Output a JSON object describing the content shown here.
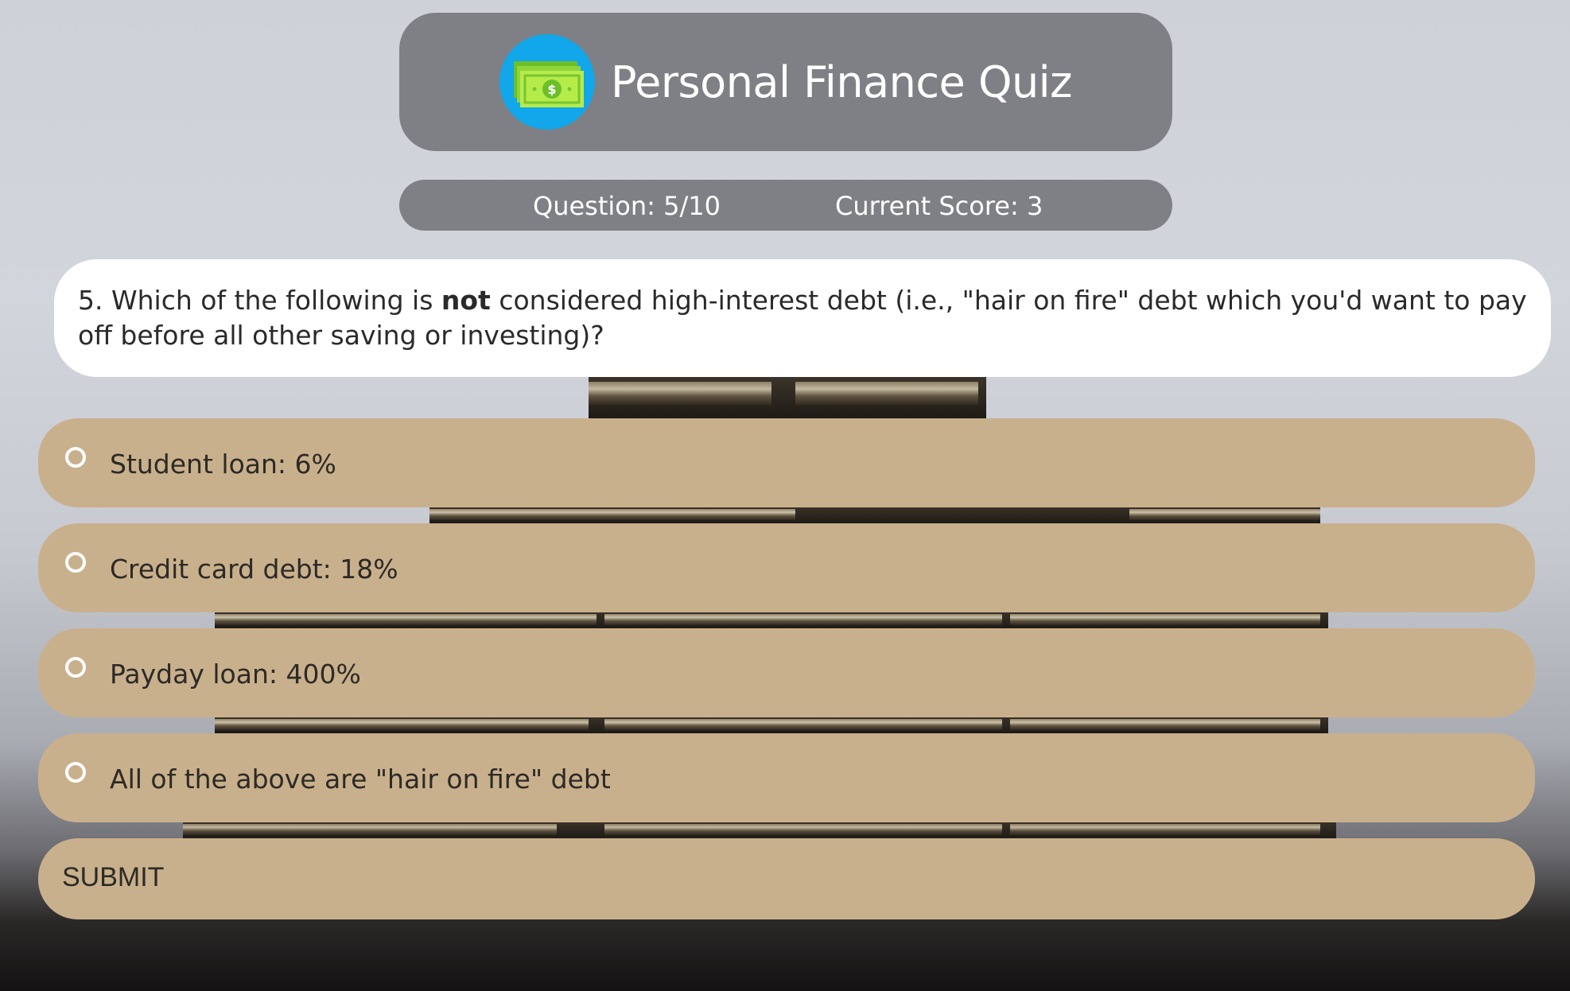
{
  "app": {
    "title": "Personal Finance Quiz",
    "logo_icon": "cash-money-icon",
    "colors": {
      "header_bg": "#7f8085",
      "logo_bg": "#12a6ea",
      "option_bg": "#c9b08c",
      "card_bg": "#ffffff"
    }
  },
  "status": {
    "question_label": "Question: 5/10",
    "score_label": "Current Score: 3",
    "question_current": 5,
    "question_total": 10,
    "score": 3
  },
  "question": {
    "prefix": "5. Which of the following is ",
    "emphasis": "not",
    "suffix": " considered high-interest debt (i.e., \"hair on fire\" debt which you'd want to pay off before all other saving or investing)?"
  },
  "options": [
    {
      "label": "Student loan: 6%",
      "selected": false
    },
    {
      "label": "Credit card debt: 18%",
      "selected": false
    },
    {
      "label": "Payday loan: 400%",
      "selected": false
    },
    {
      "label": "All of the above are \"hair on fire\" debt",
      "selected": false
    }
  ],
  "submit": {
    "label": "SUBMIT"
  }
}
